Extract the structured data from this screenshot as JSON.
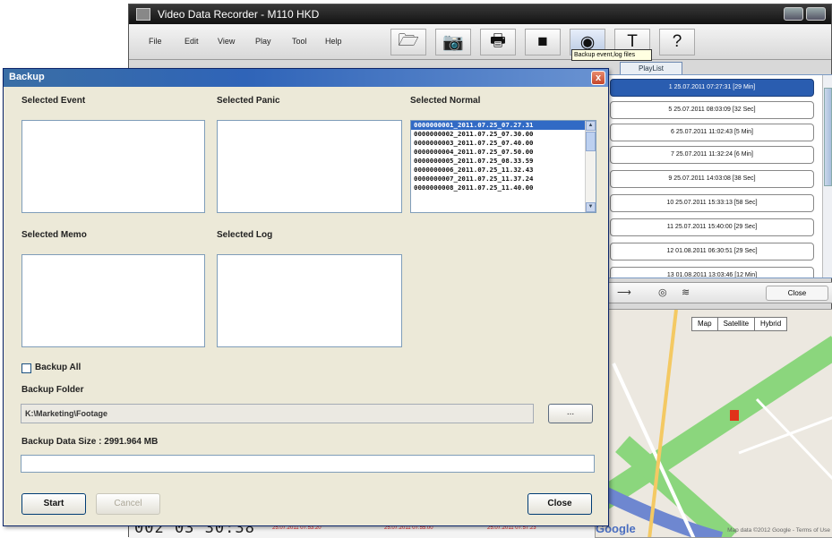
{
  "app": {
    "title": "Video Data Recorder  -  M110 HKD",
    "menu": [
      "File",
      "Edit",
      "View",
      "Play",
      "Tool",
      "Help"
    ],
    "toolbar_icons": [
      "folder-icon",
      "camera-icon",
      "printer-icon",
      "hdd-icon",
      "disc-icon",
      "tools-icon",
      "help-icon"
    ],
    "help_glyph": "?",
    "tooltip": "Backup event,log files",
    "playlist_tab": "PlayList",
    "playlist": [
      "1  25.07.2011 07:27:31 [29 Min]",
      "5  25.07.2011 08:03:09 [32 Sec]",
      "6  25.07.2011 11:02:43 [5 Min]",
      "7  25.07.2011 11:32:24 [6 Min]",
      "9  25.07.2011 14:03:08 [38 Sec]",
      "10  25.07.2011 15:33:13 [58 Sec]",
      "11  25.07.2011 15:40:00 [29 Sec]",
      "12  01.08.2011 06:30:51 [29 Sec]",
      "13  01.08.2011 13:03:46 [12 Min]"
    ],
    "playlist_selected": 0,
    "timeline_close": "Close",
    "map_types": [
      "Map",
      "Satellite",
      "Hybrid"
    ],
    "map_credit": "Map data ©2012 Google - Terms of Use",
    "map_logo": "Google",
    "clock": "002 03 30:38",
    "timeline_ticks": [
      "25.07.2011 07:53:20",
      "25.07.2011 07:55:00",
      "25.07.2011 07:57:23"
    ]
  },
  "dialog": {
    "title": "Backup",
    "close_glyph": "x",
    "selected_event_label": "Selected Event",
    "selected_panic_label": "Selected Panic",
    "selected_normal_label": "Selected Normal",
    "selected_memo_label": "Selected Memo",
    "selected_log_label": "Selected Log",
    "normal_items": [
      "0000000001_2011.07.25_07.27.31",
      "0000000002_2011.07.25_07.30.00",
      "0000000003_2011.07.25_07.40.00",
      "0000000004_2011.07.25_07.50.00",
      "0000000005_2011.07.25_08.33.59",
      "0000000006_2011.07.25_11.32.43",
      "0000000007_2011.07.25_11.37.24",
      "0000000008_2011.07.25_11.40.00"
    ],
    "normal_selected": 0,
    "backup_all_label": "Backup All",
    "backup_all_checked": false,
    "backup_folder_label": "Backup Folder",
    "backup_folder_value": "K:\\Marketing\\Footage",
    "browse_label": "...",
    "data_size_label": "Backup Data Size : 2991.964 MB",
    "progress": 0,
    "start_label": "Start",
    "cancel_label": "Cancel",
    "close_label": "Close"
  },
  "colors": {
    "title_bar": "#2f64b8",
    "selection": "#316ac5",
    "dialog_bg": "#ece9d8"
  }
}
